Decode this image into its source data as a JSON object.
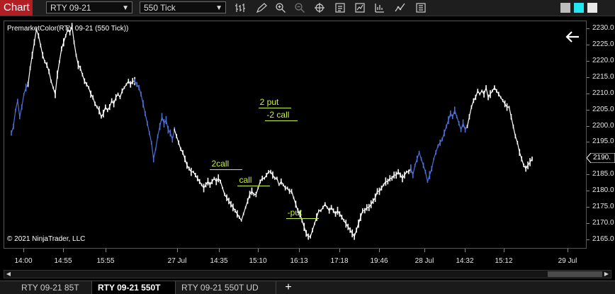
{
  "toolbar": {
    "chart_tab": "Chart",
    "instrument": "RTY 09-21",
    "interval": "550 Tick",
    "tools": [
      "bar-type-icon",
      "draw-pencil-icon",
      "zoom-in-icon",
      "zoom-out-icon",
      "crosshair-icon",
      "properties-icon",
      "strategies-icon",
      "indicators-icon",
      "drawing-tools-icon",
      "templates-icon"
    ],
    "window_squares": [
      {
        "name": "gray-square-icon",
        "color": "#bdbdbd"
      },
      {
        "name": "cyan-square-icon",
        "color": "#22e6f0"
      },
      {
        "name": "white-square-icon",
        "color": "#e8e8e8"
      }
    ]
  },
  "chart": {
    "title": "PremarketColor(RTY 09-21 (550 Tick))",
    "copyright": "© 2021 NinjaTrader, LLC",
    "current_price_label": "2190.",
    "colors": {
      "regular": "#ffffff",
      "premarket": "#4a6fd6",
      "annotation": "#c6f23a"
    }
  },
  "chart_data": {
    "type": "line",
    "x_tick_labels": [
      "14:00",
      "14:55",
      "15:55",
      "27 Jul",
      "14:35",
      "15:10",
      "16:13",
      "17:18",
      "19:46",
      "28 Jul",
      "14:32",
      "15:12",
      "29 Jul"
    ],
    "y_tick_labels": [
      "2230.0",
      "2225.0",
      "2220.0",
      "2215.0",
      "2210.0",
      "2205.0",
      "2200.0",
      "2195.0",
      "2190.0",
      "2185.0",
      "2180.0",
      "2175.0",
      "2170.0",
      "2165.0"
    ],
    "y_ticks": [
      2230,
      2225,
      2220,
      2215,
      2210,
      2205,
      2200,
      2195,
      2190,
      2185,
      2180,
      2175,
      2170,
      2165
    ],
    "ylim": [
      2162.5,
      2232.5
    ],
    "current_price": 2190,
    "series": [
      {
        "color_key": "premarket",
        "values": [
          2198,
          2200,
          2205,
          2208,
          2203,
          2206,
          2210,
          2212,
          2213
        ]
      },
      {
        "color_key": "regular",
        "values": [
          2213,
          2218,
          2222,
          2226,
          2230,
          2228,
          2225,
          2222,
          2220,
          2219,
          2217,
          2214,
          2212,
          2210,
          2216,
          2220,
          2224,
          2226,
          2228,
          2230,
          2229,
          2231,
          2226,
          2222,
          2219,
          2218,
          2216,
          2214,
          2213,
          2212,
          2210,
          2209,
          2207,
          2206,
          2205,
          2203,
          2204,
          2206,
          2205,
          2206,
          2208,
          2207,
          2209,
          2210,
          2209,
          2211,
          2212,
          2213,
          2214,
          2213,
          2214,
          2214
        ]
      },
      {
        "color_key": "premarket",
        "values": [
          2214,
          2213,
          2212,
          2210,
          2207,
          2204,
          2201,
          2198,
          2195,
          2190,
          2193,
          2197,
          2200,
          2203,
          2201,
          2202,
          2199,
          2198,
          2196,
          2199
        ]
      },
      {
        "color_key": "regular",
        "values": [
          2199,
          2197,
          2195,
          2193,
          2192,
          2190,
          2188,
          2187,
          2186,
          2186,
          2185,
          2184,
          2183,
          2182,
          2181,
          2182,
          2183,
          2182,
          2183,
          2184,
          2183,
          2184,
          2183,
          2181,
          2179,
          2178,
          2177,
          2176,
          2175,
          2174,
          2173,
          2172,
          2171,
          2173,
          2175,
          2177,
          2179,
          2180,
          2179,
          2179,
          2181,
          2183,
          2184,
          2184,
          2185,
          2186,
          2186,
          2185,
          2184,
          2184,
          2182,
          2183,
          2182,
          2181,
          2181,
          2180,
          2180,
          2178,
          2176,
          2174,
          2173,
          2171,
          2169,
          2167,
          2166,
          2166,
          2168,
          2170,
          2172,
          2174,
          2174,
          2175,
          2176,
          2175,
          2174,
          2175,
          2174,
          2173,
          2174,
          2173,
          2172,
          2171,
          2170,
          2169,
          2168,
          2167,
          2166,
          2168,
          2170,
          2172,
          2174,
          2174,
          2175,
          2175,
          2176,
          2177,
          2178,
          2180,
          2180,
          2181,
          2182,
          2183,
          2183,
          2184,
          2184,
          2185,
          2185,
          2186,
          2185,
          2184,
          2185,
          2186,
          2186,
          2187
        ]
      },
      {
        "color_key": "premarket",
        "values": [
          2187,
          2185,
          2188,
          2190,
          2192,
          2190,
          2188,
          2186,
          2183,
          2185,
          2187,
          2190,
          2192,
          2194,
          2195,
          2196,
          2198,
          2200,
          2202,
          2204,
          2203,
          2205,
          2203,
          2201,
          2199,
          2201,
          2199,
          2200
        ]
      },
      {
        "color_key": "regular",
        "values": [
          2200,
          2203,
          2206,
          2208,
          2209,
          2211,
          2210,
          2211,
          2210,
          2212,
          2209,
          2210,
          2211,
          2212,
          2211,
          2210,
          2209,
          2208,
          2207,
          2206,
          2206,
          2203,
          2200,
          2197,
          2195,
          2192,
          2190,
          2188,
          2187,
          2188,
          2189,
          2190
        ]
      }
    ],
    "annotations": [
      {
        "text": "2 put",
        "x": 36,
        "y": 2206
      },
      {
        "text": "-2 call",
        "x": 37,
        "y": 2202
      },
      {
        "text": "2call",
        "x": 29,
        "y": 2187
      },
      {
        "text": "call",
        "x": 33,
        "y": 2182
      },
      {
        "text": "-put",
        "x": 40,
        "y": 2172
      }
    ]
  },
  "bottom_tabs": [
    {
      "label": "RTY 09-21 85T",
      "active": false
    },
    {
      "label": "RTY 09-21 550T",
      "active": true
    },
    {
      "label": "RTY 09-21 550T UD",
      "active": false
    }
  ],
  "add_tab_label": "+"
}
